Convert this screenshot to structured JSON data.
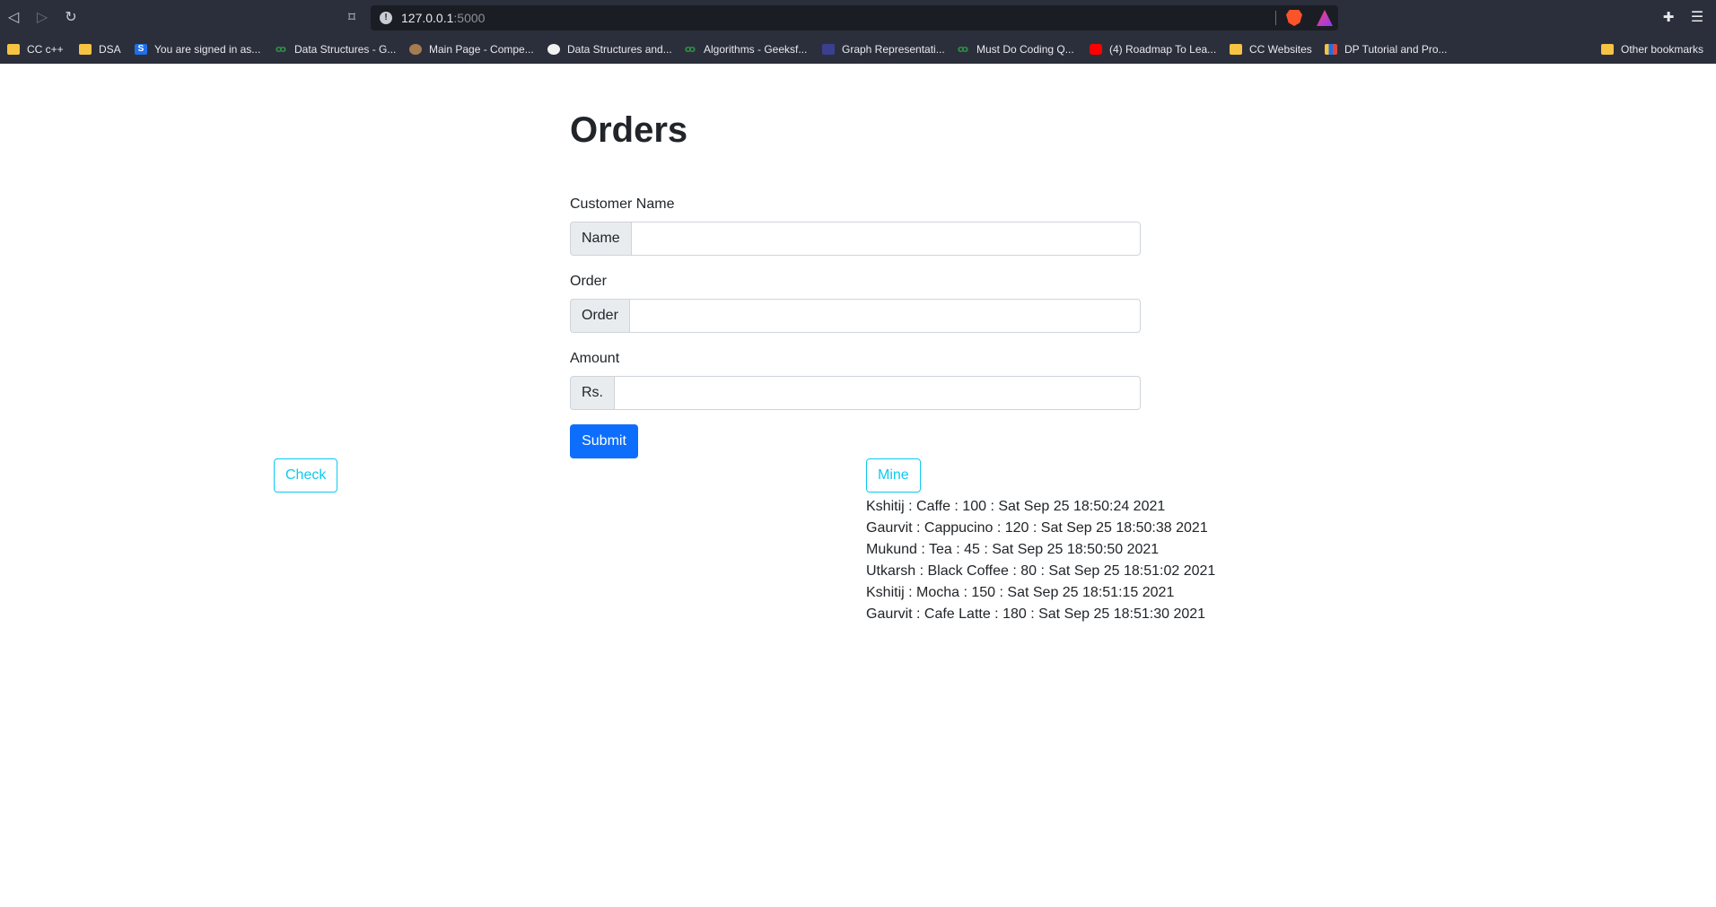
{
  "browser": {
    "url_host": "127.0.0.1",
    "url_port": ":5000",
    "bookmarks": [
      {
        "label": "CC c++",
        "icon": "folder"
      },
      {
        "label": "DSA",
        "icon": "folder"
      },
      {
        "label": "You are signed in as...",
        "icon": "s"
      },
      {
        "label": "Data Structures - G...",
        "icon": "gfg"
      },
      {
        "label": "Main Page - Compe...",
        "icon": "cp"
      },
      {
        "label": "Data Structures and...",
        "icon": "chef"
      },
      {
        "label": "Algorithms - Geeksf...",
        "icon": "gfg"
      },
      {
        "label": "Graph Representati...",
        "icon": "graph"
      },
      {
        "label": "Must Do Coding Q...",
        "icon": "gfg"
      },
      {
        "label": "(4) Roadmap To Lea...",
        "icon": "yt"
      },
      {
        "label": "CC Websites",
        "icon": "folder"
      },
      {
        "label": "DP Tutorial and Pro...",
        "icon": "bars"
      }
    ],
    "other_bookmarks": "Other bookmarks"
  },
  "page": {
    "title": "Orders",
    "form": {
      "customer_label": "Customer Name",
      "customer_addon": "Name",
      "customer_value": "",
      "order_label": "Order",
      "order_addon": "Order",
      "order_value": "",
      "amount_label": "Amount",
      "amount_addon": "Rs.",
      "amount_value": "",
      "submit_label": "Submit"
    },
    "check_label": "Check",
    "mine_label": "Mine",
    "orders": [
      "Kshitij : Caffe : 100 : Sat Sep 25 18:50:24 2021",
      "Gaurvit : Cappucino : 120 : Sat Sep 25 18:50:38 2021",
      "Mukund : Tea : 45 : Sat Sep 25 18:50:50 2021",
      "Utkarsh : Black Coffee : 80 : Sat Sep 25 18:51:02 2021",
      "Kshitij : Mocha : 150 : Sat Sep 25 18:51:15 2021",
      "Gaurvit : Cafe Latte : 180 : Sat Sep 25 18:51:30 2021"
    ]
  },
  "colors": {
    "chrome_bg": "#2b2f3b",
    "primary": "#0d6efd",
    "info": "#0dcaf0"
  }
}
